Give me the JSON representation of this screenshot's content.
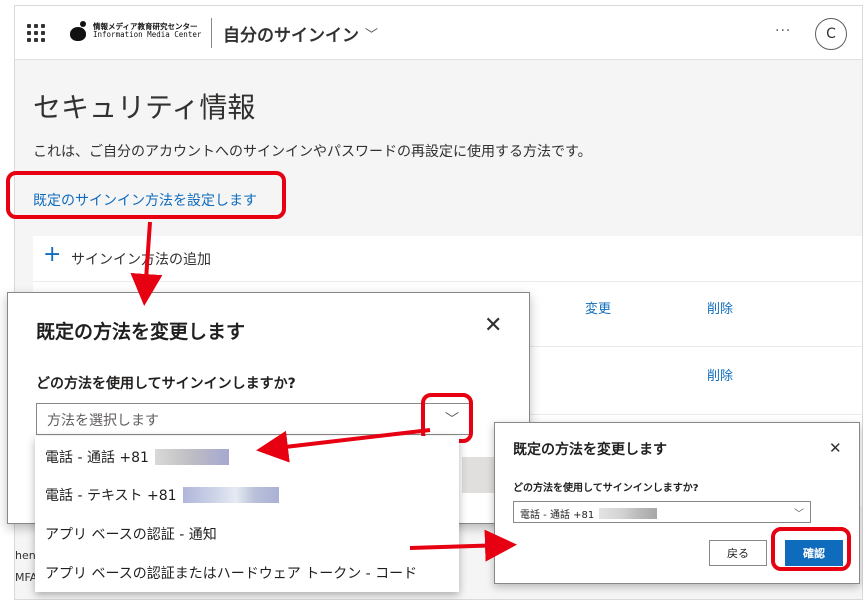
{
  "header": {
    "logo_jp": "情報メディア教育研究センター",
    "logo_en": "Information Media Center",
    "app_title": "自分のサインイン",
    "more": "···",
    "avatar_initial": "C"
  },
  "main": {
    "title": "セキュリティ情報",
    "description": "これは、ご自分のアカウントへのサインインやパスワードの再設定に使用する方法です。",
    "default_link": "既定のサインイン方法を設定します",
    "add_method": "サインイン方法の追加",
    "change": "変更",
    "delete": "削除",
    "edge_text_1": "henti",
    "edge_text_2": "MFA)"
  },
  "dialog1": {
    "title": "既定の方法を変更します",
    "question": "どの方法を使用してサインインしますか?",
    "placeholder": "方法を選択します",
    "options": [
      "電話 - 通話 +81",
      "電話 - テキスト +81",
      "アプリ ベースの認証 - 通知",
      "アプリ ベースの認証またはハードウェア トークン - コード"
    ]
  },
  "dialog2": {
    "title": "既定の方法を変更します",
    "question": "どの方法を使用してサインインしますか?",
    "selected_value": "電話 - 通話 +81",
    "back_label": "戻る",
    "confirm_label": "確認"
  },
  "colors": {
    "accent": "#0f6cbd",
    "highlight": "#e60012"
  }
}
